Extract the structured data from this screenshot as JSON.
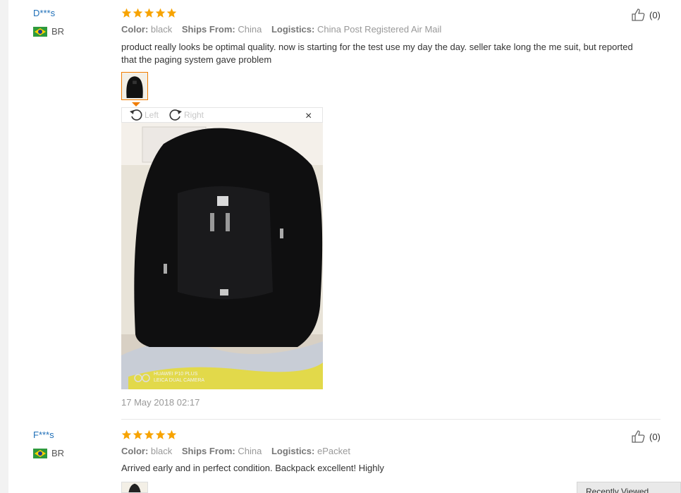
{
  "reviews": [
    {
      "user": "D***s",
      "country": "BR",
      "rating": 5,
      "attrs": {
        "color_label": "Color:",
        "color": "black",
        "ships_label": "Ships From:",
        "ships": "China",
        "logistics_label": "Logistics:",
        "logistics": "China Post Registered Air Mail"
      },
      "text": "product really looks be optimal quality. now is starting for the test use my day the day. seller take long the me suit, but reported that the paging system gave problem",
      "helpful": "(0)",
      "viewer": {
        "left_label": "Left",
        "right_label": "Right",
        "close": "×"
      },
      "photo_watermark_line1": "HUAWEI P10 PLUS",
      "photo_watermark_line2": "LEICA DUAL CAMERA",
      "date": "17 May 2018 02:17"
    },
    {
      "user": "F***s",
      "country": "BR",
      "rating": 5,
      "attrs": {
        "color_label": "Color:",
        "color": "black",
        "ships_label": "Ships From:",
        "ships": "China",
        "logistics_label": "Logistics:",
        "logistics": "ePacket"
      },
      "text": "Arrived early and in perfect condition. Backpack excellent! Highly",
      "helpful": "(0)"
    }
  ],
  "recently_viewed": "Recently Viewed",
  "colors": {
    "star": "#f7a300",
    "link": "#1f6fb8",
    "accent": "#f07c00"
  }
}
